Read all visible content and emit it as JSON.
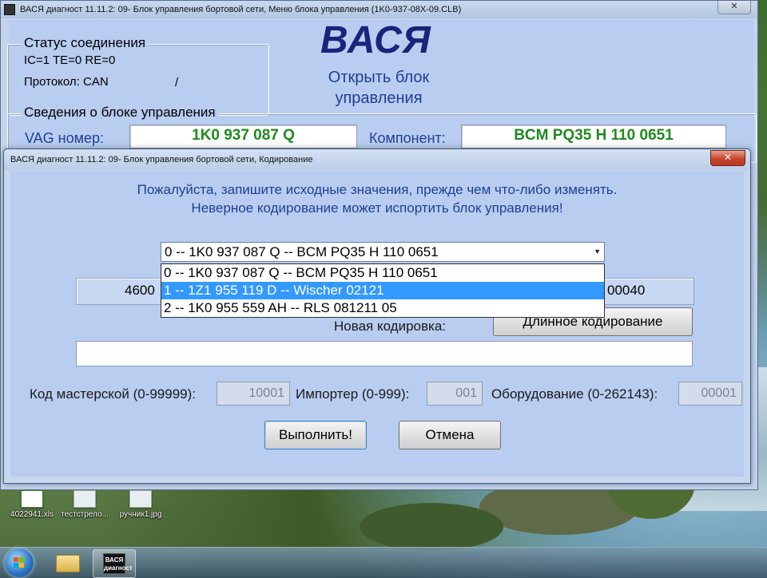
{
  "back_window": {
    "title": "ВАСЯ диагност 11.11.2: 09- Блок управления бортовой сети,  Меню блока управления (1K0-937-08X-09.CLB)",
    "close": "✕",
    "status_group": {
      "title": "Статус соединения",
      "line1": "IC=1  TE=0   RE=0",
      "protocol": "Протокол: CAN",
      "slash": "/"
    },
    "logo": "ВАСЯ",
    "open_block_line1": "Открыть блок",
    "open_block_line2": "управления",
    "info_group": {
      "title": "Сведения о блоке управления",
      "vag_label": "VAG номер:",
      "vag_value": "1K0 937 087 Q",
      "component_label": "Компонент:",
      "component_value": "BCM PQ35  H   110 0651"
    }
  },
  "dialog": {
    "title": "ВАСЯ диагност 11.11.2: 09- Блок управления бортовой сети,  Кодирование",
    "close": "✕",
    "warning_line1": "Пожалуйста, запишите исходные значения, прежде чем что-либо изменять.",
    "warning_line2": "Неверное кодирование может испортить блок управления!",
    "combo_selected": "0 -- 1K0 937 087 Q -- BCM PQ35  H    110 0651",
    "combo_arrow": "▼",
    "dropdown_options": [
      "0 -- 1K0 937 087 Q -- BCM PQ35  H    110 0651",
      "1 -- 1Z1 955 119 D -- Wischer 02121",
      "2 -- 1K0 955 559 AH -- RLS 081211 05"
    ],
    "dropdown_selected_index": 1,
    "coding_left_partial": "4600",
    "coding_right_partial": "00040",
    "new_coding_label": "Новая кодировка:",
    "long_coding_button": "Длинное кодирование",
    "new_coding_value": "",
    "workshop_label": "Код мастерской (0-99999):",
    "workshop_value": "10001",
    "importer_label": "Импортер (0-999):",
    "importer_value": "001",
    "equipment_label": "Оборудование (0-262143):",
    "equipment_value": "00001",
    "execute_button": "Выполнить!",
    "cancel_button": "Отмена"
  },
  "desktop_icons": [
    {
      "label": "4022941.xls",
      "icon": "excel-file-icon"
    },
    {
      "label": "тестстрело...",
      "icon": "image-file-icon"
    },
    {
      "label": "ручник1.jpg",
      "icon": "image-file-icon"
    }
  ],
  "taskbar": {
    "start": "start-button",
    "vasya_icon_text": "ВАСЯ диагност"
  },
  "colors": {
    "window_bg": "#b8cdf0",
    "value_green": "#1f8a1f",
    "logo_blue": "#1b237b",
    "selection_blue": "#3399ff",
    "close_red": "#c6452c"
  }
}
